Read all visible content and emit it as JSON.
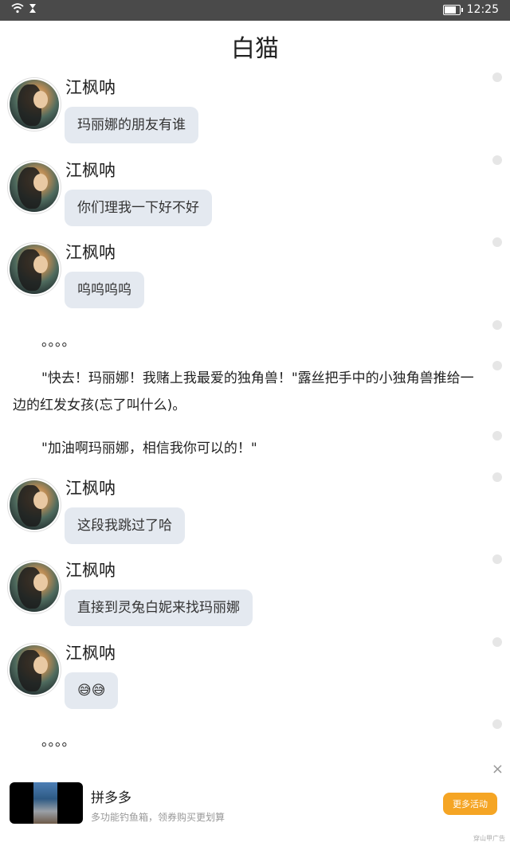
{
  "status_bar": {
    "time": "12:25"
  },
  "page": {
    "title": "白猫"
  },
  "messages": [
    {
      "name": "江枫呐",
      "text": "玛丽娜的朋友有谁"
    },
    {
      "name": "江枫呐",
      "text": "你们理我一下好不好"
    },
    {
      "name": "江枫呐",
      "text": "呜呜呜呜"
    },
    {
      "name": "江枫呐",
      "text": "这段我跳过了哈"
    },
    {
      "name": "江枫呐",
      "text": "直接到灵兔白妮来找玛丽娜"
    },
    {
      "name": "江枫呐",
      "text": "😅😅"
    }
  ],
  "narration": [
    "。。。。",
    "\"快去！玛丽娜！我赌上我最爱的独角兽！\"露丝把手中的小独角兽推给一边的红发女孩(忘了叫什么)。",
    "\"加油啊玛丽娜，相信我你可以的！\"",
    "。。。。"
  ],
  "ad": {
    "title": "拼多多",
    "description": "多功能钓鱼箱，领券购买更划算",
    "button": "更多活动",
    "mark": "穿山甲广告",
    "close": "×"
  },
  "colors": {
    "bubble": "#e4e9f0",
    "ad_button": "#f5a524",
    "status_bar": "#4a4a4a"
  }
}
